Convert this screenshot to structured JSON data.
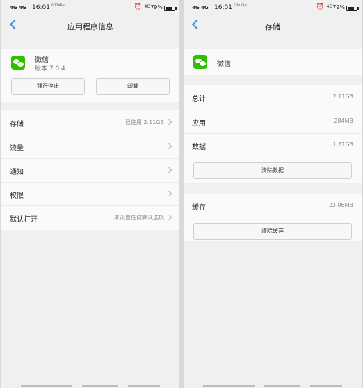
{
  "status_bar": {
    "signal": "4G 4G",
    "time": "16:01",
    "speed": "0.20 KB/s",
    "network": "4G",
    "battery": "79%"
  },
  "left": {
    "header": {
      "title": "应用程序信息"
    },
    "app": {
      "name": "微信",
      "version": "版本 7.0.4"
    },
    "buttons": {
      "force_stop": "强行停止",
      "uninstall": "卸载"
    },
    "rows": [
      {
        "label": "存储",
        "value": "已使用 2.11GB"
      },
      {
        "label": "流量",
        "value": ""
      },
      {
        "label": "通知",
        "value": ""
      },
      {
        "label": "权限",
        "value": ""
      },
      {
        "label": "默认打开",
        "value": "未设置任何默认选项"
      }
    ]
  },
  "right": {
    "header": {
      "title": "存储"
    },
    "app": {
      "name": "微信"
    },
    "rows": [
      {
        "label": "总计",
        "value": "2.11GB"
      },
      {
        "label": "应用",
        "value": "284MB"
      },
      {
        "label": "数据",
        "value": "1.81GB"
      }
    ],
    "clear_data": "清除数据",
    "cache": {
      "label": "缓存",
      "value": "23.06MB"
    },
    "clear_cache": "清除缓存"
  }
}
